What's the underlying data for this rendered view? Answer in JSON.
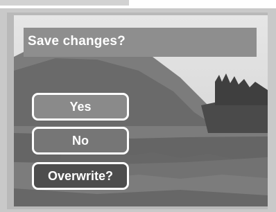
{
  "dialog": {
    "title": "Save changes?",
    "options": [
      {
        "label": "Yes",
        "selected": false
      },
      {
        "label": "No",
        "selected": false
      },
      {
        "label": "Overwrite?",
        "selected": true
      }
    ]
  },
  "colors": {
    "bezel": "#c9c9c9",
    "title_bar": "#8e8e8e",
    "option_text": "#ffffff",
    "option_border": "#ffffff",
    "selected_option": "#4d4d4d"
  }
}
